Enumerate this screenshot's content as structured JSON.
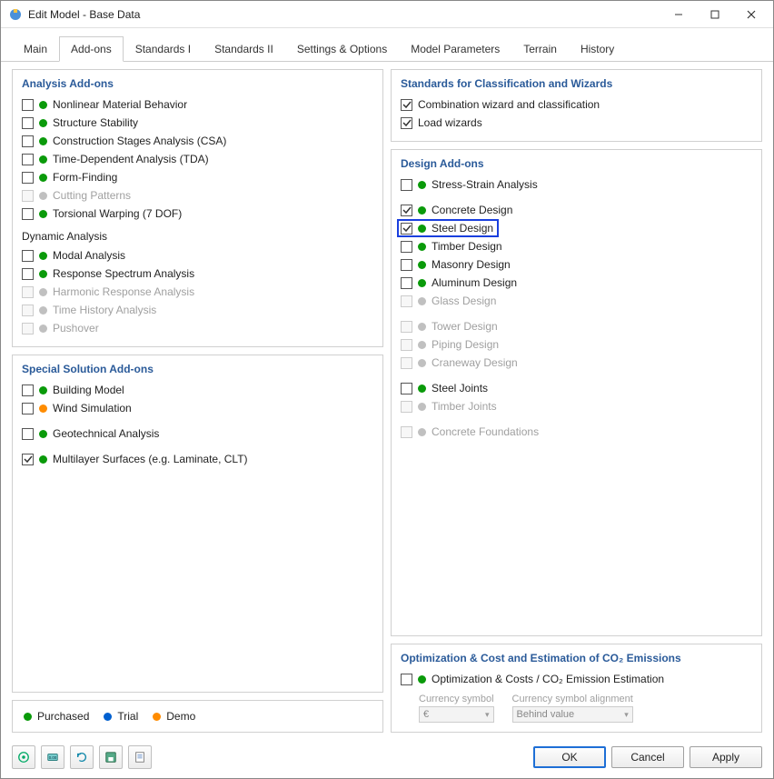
{
  "window": {
    "title": "Edit Model - Base Data"
  },
  "tabs": [
    {
      "id": "main",
      "label": "Main"
    },
    {
      "id": "addons",
      "label": "Add-ons"
    },
    {
      "id": "std1",
      "label": "Standards I"
    },
    {
      "id": "std2",
      "label": "Standards II"
    },
    {
      "id": "settings",
      "label": "Settings & Options"
    },
    {
      "id": "modelparams",
      "label": "Model Parameters"
    },
    {
      "id": "terrain",
      "label": "Terrain"
    },
    {
      "id": "history",
      "label": "History"
    }
  ],
  "active_tab": "addons",
  "panels": {
    "analysis": {
      "title": "Analysis Add-ons",
      "items": [
        {
          "label": "Nonlinear Material Behavior",
          "status": "green",
          "checked": false,
          "disabled": false
        },
        {
          "label": "Structure Stability",
          "status": "green",
          "checked": false,
          "disabled": false
        },
        {
          "label": "Construction Stages Analysis (CSA)",
          "status": "green",
          "checked": false,
          "disabled": false
        },
        {
          "label": "Time-Dependent Analysis (TDA)",
          "status": "green",
          "checked": false,
          "disabled": false
        },
        {
          "label": "Form-Finding",
          "status": "green",
          "checked": false,
          "disabled": false
        },
        {
          "label": "Cutting Patterns",
          "status": "grey",
          "checked": false,
          "disabled": true
        },
        {
          "label": "Torsional Warping (7 DOF)",
          "status": "green",
          "checked": false,
          "disabled": false
        }
      ],
      "dynamic_header": "Dynamic Analysis",
      "dynamic_items": [
        {
          "label": "Modal Analysis",
          "status": "green",
          "checked": false,
          "disabled": false
        },
        {
          "label": "Response Spectrum Analysis",
          "status": "green",
          "checked": false,
          "disabled": false
        },
        {
          "label": "Harmonic Response Analysis",
          "status": "grey",
          "checked": false,
          "disabled": true
        },
        {
          "label": "Time History Analysis",
          "status": "grey",
          "checked": false,
          "disabled": true
        },
        {
          "label": "Pushover",
          "status": "grey",
          "checked": false,
          "disabled": true
        }
      ]
    },
    "special": {
      "title": "Special Solution Add-ons",
      "items": [
        {
          "label": "Building Model",
          "status": "green",
          "checked": false,
          "disabled": false
        },
        {
          "label": "Wind Simulation",
          "status": "orange",
          "checked": false,
          "disabled": false
        }
      ],
      "items2": [
        {
          "label": "Geotechnical Analysis",
          "status": "green",
          "checked": false,
          "disabled": false
        }
      ],
      "items3": [
        {
          "label": "Multilayer Surfaces (e.g. Laminate, CLT)",
          "status": "green",
          "checked": true,
          "disabled": false
        }
      ]
    },
    "standards": {
      "title": "Standards for Classification and Wizards",
      "items": [
        {
          "label": "Combination wizard and classification",
          "checked": true
        },
        {
          "label": "Load wizards",
          "checked": true
        }
      ]
    },
    "design": {
      "title": "Design Add-ons",
      "groups": [
        [
          {
            "label": "Stress-Strain Analysis",
            "status": "green",
            "checked": false,
            "disabled": false
          }
        ],
        [
          {
            "label": "Concrete Design",
            "status": "green",
            "checked": true,
            "disabled": false
          },
          {
            "label": "Steel Design",
            "status": "green",
            "checked": true,
            "disabled": false,
            "highlight": true
          },
          {
            "label": "Timber Design",
            "status": "green",
            "checked": false,
            "disabled": false
          },
          {
            "label": "Masonry Design",
            "status": "green",
            "checked": false,
            "disabled": false
          },
          {
            "label": "Aluminum Design",
            "status": "green",
            "checked": false,
            "disabled": false
          },
          {
            "label": "Glass Design",
            "status": "grey",
            "checked": false,
            "disabled": true
          }
        ],
        [
          {
            "label": "Tower Design",
            "status": "grey",
            "checked": false,
            "disabled": true
          },
          {
            "label": "Piping Design",
            "status": "grey",
            "checked": false,
            "disabled": true
          },
          {
            "label": "Craneway Design",
            "status": "grey",
            "checked": false,
            "disabled": true
          }
        ],
        [
          {
            "label": "Steel Joints",
            "status": "green",
            "checked": false,
            "disabled": false
          },
          {
            "label": "Timber Joints",
            "status": "grey",
            "checked": false,
            "disabled": true
          }
        ],
        [
          {
            "label": "Concrete Foundations",
            "status": "grey",
            "checked": false,
            "disabled": true
          }
        ]
      ]
    },
    "optimization": {
      "title": "Optimization & Cost and Estimation of CO₂ Emissions",
      "item": {
        "label": "Optimization & Costs / CO₂ Emission Estimation",
        "status": "green",
        "checked": false,
        "disabled": false
      },
      "currency_label": "Currency symbol",
      "currency_value": "€",
      "alignment_label": "Currency symbol alignment",
      "alignment_value": "Behind value"
    }
  },
  "legend": {
    "purchased": "Purchased",
    "trial": "Trial",
    "demo": "Demo"
  },
  "buttons": {
    "ok": "OK",
    "cancel": "Cancel",
    "apply": "Apply"
  }
}
